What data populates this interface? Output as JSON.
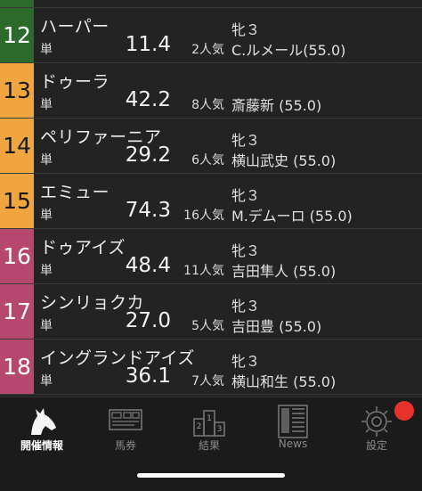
{
  "rows": [
    {
      "num": "12",
      "color": "#2c6a2c",
      "name": "ハーパー",
      "tan": "単",
      "odds": "11.4",
      "popular": "2人気",
      "sexage": "牝３",
      "jockey": "C.ルメール(55.0)"
    },
    {
      "num": "13",
      "color": "#f0a53e",
      "name": "ドゥーラ",
      "tan": "単",
      "odds": "42.2",
      "popular": "8人気",
      "sexage": "",
      "jockey": "斎藤新 (55.0)"
    },
    {
      "num": "14",
      "color": "#f0a53e",
      "name": "ペリファーニア",
      "tan": "単",
      "odds": "29.2",
      "popular": "6人気",
      "sexage": "牝３",
      "jockey": "横山武史 (55.0)"
    },
    {
      "num": "15",
      "color": "#f0a53e",
      "name": "エミュー",
      "tan": "単",
      "odds": "74.3",
      "popular": "16人気",
      "sexage": "牝３",
      "jockey": "M.デムーロ (55.0)"
    },
    {
      "num": "16",
      "color": "#b6476e",
      "name": "ドゥアイズ",
      "tan": "単",
      "odds": "48.4",
      "popular": "11人気",
      "sexage": "牝３",
      "jockey": "吉田隼人 (55.0)"
    },
    {
      "num": "17",
      "color": "#b6476e",
      "name": "シンリョクカ",
      "tan": "単",
      "odds": "27.0",
      "popular": "5人気",
      "sexage": "牝３",
      "jockey": "吉田豊 (55.0)"
    },
    {
      "num": "18",
      "color": "#b6476e",
      "name": "イングランドアイズ",
      "tan": "単",
      "odds": "36.1",
      "popular": "7人気",
      "sexage": "牝３",
      "jockey": "横山和生 (55.0)"
    }
  ],
  "tabs": [
    {
      "label": "開催情報",
      "icon": "horse-head-icon",
      "active": true
    },
    {
      "label": "馬券",
      "icon": "ticket-icon",
      "active": false
    },
    {
      "label": "結果",
      "icon": "podium-icon",
      "active": false
    },
    {
      "label": "News",
      "icon": "newspaper-icon",
      "active": false
    },
    {
      "label": "設定",
      "icon": "gear-icon",
      "active": false
    }
  ]
}
